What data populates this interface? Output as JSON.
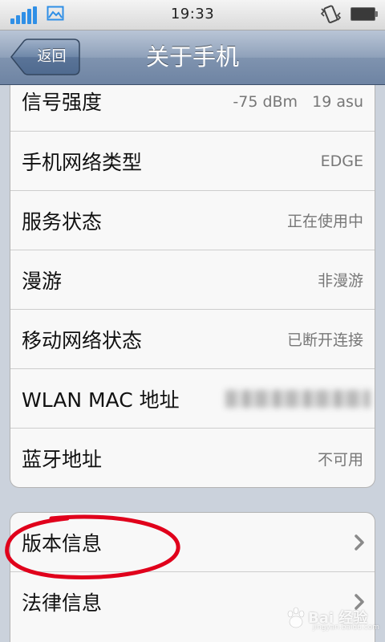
{
  "status_bar": {
    "time": "19:33",
    "signal_color": "#2f8fe6",
    "icons": [
      "signal-icon",
      "picture-icon",
      "vibrate-icon",
      "battery-icon"
    ]
  },
  "nav": {
    "back_label": "返回",
    "title": "关于手机"
  },
  "group1": {
    "rows": [
      {
        "label": "信号强度",
        "value": "-75 dBm   19 asu"
      },
      {
        "label": "手机网络类型",
        "value": "EDGE"
      },
      {
        "label": "服务状态",
        "value": "正在使用中"
      },
      {
        "label": "漫游",
        "value": "非漫游"
      },
      {
        "label": "移动网络状态",
        "value": "已断开连接"
      },
      {
        "label": "WLAN MAC 地址",
        "value": ""
      },
      {
        "label": "蓝牙地址",
        "value": "不可用"
      }
    ]
  },
  "group2": {
    "rows": [
      {
        "label": "版本信息"
      },
      {
        "label": "法律信息"
      }
    ]
  },
  "annotation": {
    "color": "#e0001b",
    "target": "版本信息"
  },
  "watermark": {
    "text": "Bai 经验",
    "sub": "jingyan.baidu.com"
  }
}
